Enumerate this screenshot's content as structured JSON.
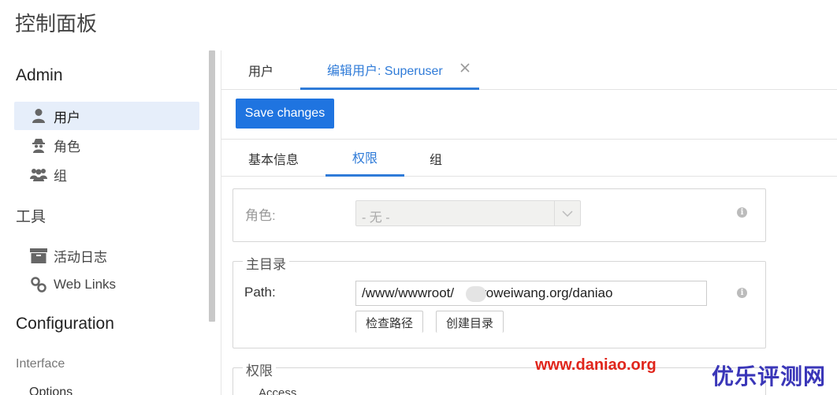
{
  "page_title": "控制面板",
  "sidebar": {
    "admin_heading": "Admin",
    "admin_items": [
      {
        "label": "用户",
        "icon": "user-icon"
      },
      {
        "label": "角色",
        "icon": "spy-icon"
      },
      {
        "label": "组",
        "icon": "users-icon"
      }
    ],
    "tools_heading": "工具",
    "tools_items": [
      {
        "label": "活动日志",
        "icon": "archive-icon"
      },
      {
        "label": "Web Links",
        "icon": "link-icon"
      }
    ],
    "config_heading": "Configuration",
    "interface_label": "Interface",
    "options_label": "Options"
  },
  "tabs": [
    {
      "label": "用户"
    },
    {
      "label": "编辑用户: Superuser"
    }
  ],
  "toolbar": {
    "save_label": "Save changes"
  },
  "subtabs": [
    {
      "label": "基本信息"
    },
    {
      "label": "权限"
    },
    {
      "label": "组"
    }
  ],
  "role_field": {
    "label": "角色:",
    "value": "- 无 -"
  },
  "home_dir": {
    "legend": "主目录",
    "path_label": "Path:",
    "path_value": "/www/wwwroot/     .woweiwang.org/daniao",
    "check_button": "检查路径",
    "create_button": "创建目录"
  },
  "permissions": {
    "legend": "权限",
    "access_label": "Access"
  },
  "watermark": {
    "url": "www.daniao.org",
    "brand": "优乐评测网"
  },
  "colors": {
    "accent": "#1f74e0",
    "active_bg": "#e6eefa",
    "watermark_red": "#e0251b",
    "watermark_blue": "#3a36b8"
  }
}
